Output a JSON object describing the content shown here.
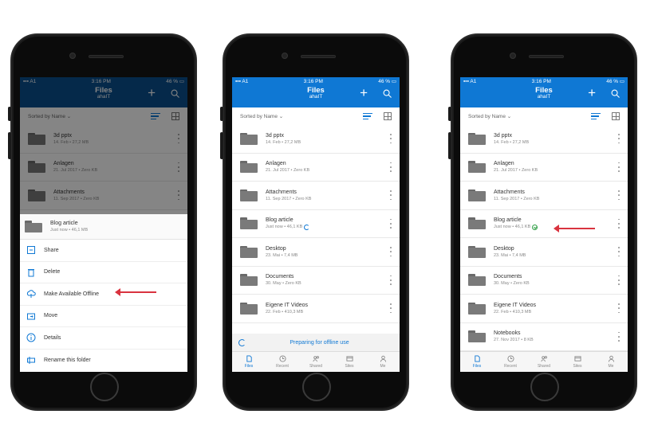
{
  "status": {
    "carrier": "A1",
    "time": "3:16 PM",
    "battery": "46 %"
  },
  "header": {
    "title": "Files",
    "subtitle": "ahaIT"
  },
  "sort_label": "Sorted by Name",
  "files": [
    {
      "name": "3d pptx",
      "meta": "14. Feb • 27,2 MB"
    },
    {
      "name": "Anlagen",
      "meta": "21. Jul 2017 • Zero KB"
    },
    {
      "name": "Attachments",
      "meta": "11. Sep 2017 • Zero KB"
    },
    {
      "name": "Blog article",
      "meta": "Just now • 46,1 KB"
    },
    {
      "name": "Desktop",
      "meta": "23. Mai • 7,4 MB"
    },
    {
      "name": "Documents",
      "meta": "30. May • Zero KB"
    },
    {
      "name": "Eigene IT Videos",
      "meta": "22. Feb • 410,3 MB"
    },
    {
      "name": "Notebooks",
      "meta": "27. Nov 2017 • 8 KB"
    }
  ],
  "sheet": {
    "item_name": "Blog article",
    "item_meta": "Just now • 46,1 MB",
    "actions": [
      "Share",
      "Delete",
      "Make Available Offline",
      "Move",
      "Details",
      "Rename this folder"
    ]
  },
  "preparing_text": "Preparing for offline use",
  "tabs": [
    "Files",
    "Recent",
    "Shared",
    "Sites",
    "Me"
  ],
  "colors": {
    "accent": "#0f78d4",
    "header_dark": "#0a4f8e",
    "arrow": "#d9333f",
    "available": "#2e9e44"
  }
}
